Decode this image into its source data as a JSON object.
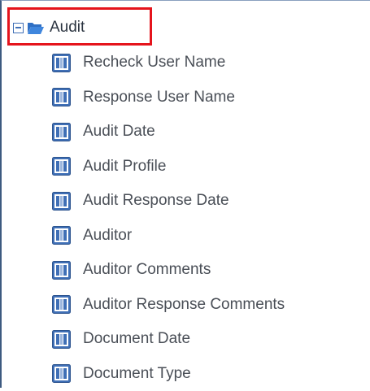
{
  "tree": {
    "root": {
      "label": "Audit",
      "expander_icon": "collapse-minus-icon",
      "icon": "folder-open-icon",
      "highlighted": true
    },
    "children": [
      {
        "label": "Recheck User Name",
        "icon": "field-column-icon"
      },
      {
        "label": "Response User Name",
        "icon": "field-column-icon"
      },
      {
        "label": "Audit Date",
        "icon": "field-column-icon"
      },
      {
        "label": "Audit Profile",
        "icon": "field-column-icon"
      },
      {
        "label": "Audit Response Date",
        "icon": "field-column-icon"
      },
      {
        "label": "Auditor",
        "icon": "field-column-icon"
      },
      {
        "label": "Auditor Comments",
        "icon": "field-column-icon"
      },
      {
        "label": "Auditor Response Comments",
        "icon": "field-column-icon"
      },
      {
        "label": "Document Date",
        "icon": "field-column-icon"
      },
      {
        "label": "Document Type",
        "icon": "field-column-icon"
      }
    ]
  },
  "colors": {
    "highlight": "#e5141c",
    "icon_blue": "#3f6fb6",
    "text": "#4a4f57"
  }
}
